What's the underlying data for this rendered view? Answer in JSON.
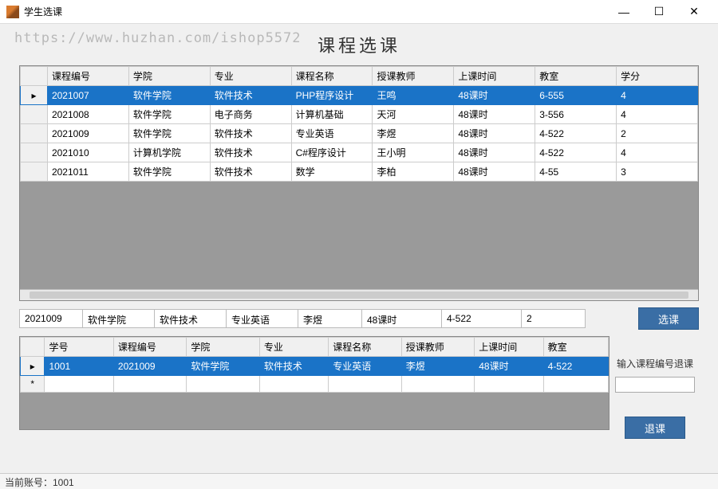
{
  "window": {
    "title": "学生选课"
  },
  "heading": "课程选课",
  "watermark": "https://www.huzhan.com/ishop5572",
  "grid1": {
    "headers": [
      "课程编号",
      "学院",
      "专业",
      "课程名称",
      "授课教师",
      "上课时间",
      "教室",
      "学分"
    ],
    "rows": [
      {
        "sel": true,
        "cells": [
          "2021007",
          "软件学院",
          "软件技术",
          "PHP程序设计",
          "王鸣",
          "48课时",
          "6-555",
          "4"
        ]
      },
      {
        "sel": false,
        "cells": [
          "2021008",
          "软件学院",
          "电子商务",
          "计算机基础",
          "天河",
          "48课时",
          "3-556",
          "4"
        ]
      },
      {
        "sel": false,
        "cells": [
          "2021009",
          "软件学院",
          "软件技术",
          "专业英语",
          "李煜",
          "48课时",
          "4-522",
          "2"
        ]
      },
      {
        "sel": false,
        "cells": [
          "2021010",
          "计算机学院",
          "软件技术",
          "C#程序设计",
          "王小明",
          "48课时",
          "4-522",
          "4"
        ]
      },
      {
        "sel": false,
        "cells": [
          "2021011",
          "软件学院",
          "软件技术",
          "数学",
          "李柏",
          "48课时",
          "4-55",
          "3"
        ]
      }
    ]
  },
  "mid": {
    "cells": [
      "2021009",
      "软件学院",
      "软件技术",
      "专业英语",
      "李煜",
      "48课时",
      "4-522",
      "2"
    ],
    "button": "选课"
  },
  "grid2": {
    "headers": [
      "学号",
      "课程编号",
      "学院",
      "专业",
      "课程名称",
      "授课教师",
      "上课时间",
      "教室"
    ],
    "rows": [
      {
        "sel": true,
        "new": false,
        "cells": [
          "1001",
          "2021009",
          "软件学院",
          "软件技术",
          "专业英语",
          "李煜",
          "48课时",
          "4-522"
        ]
      },
      {
        "sel": false,
        "new": true,
        "cells": [
          "",
          "",
          "",
          "",
          "",
          "",
          "",
          ""
        ]
      }
    ]
  },
  "side": {
    "label": "输入课程编号退课",
    "button": "退课"
  },
  "status": "当前账号：1001"
}
